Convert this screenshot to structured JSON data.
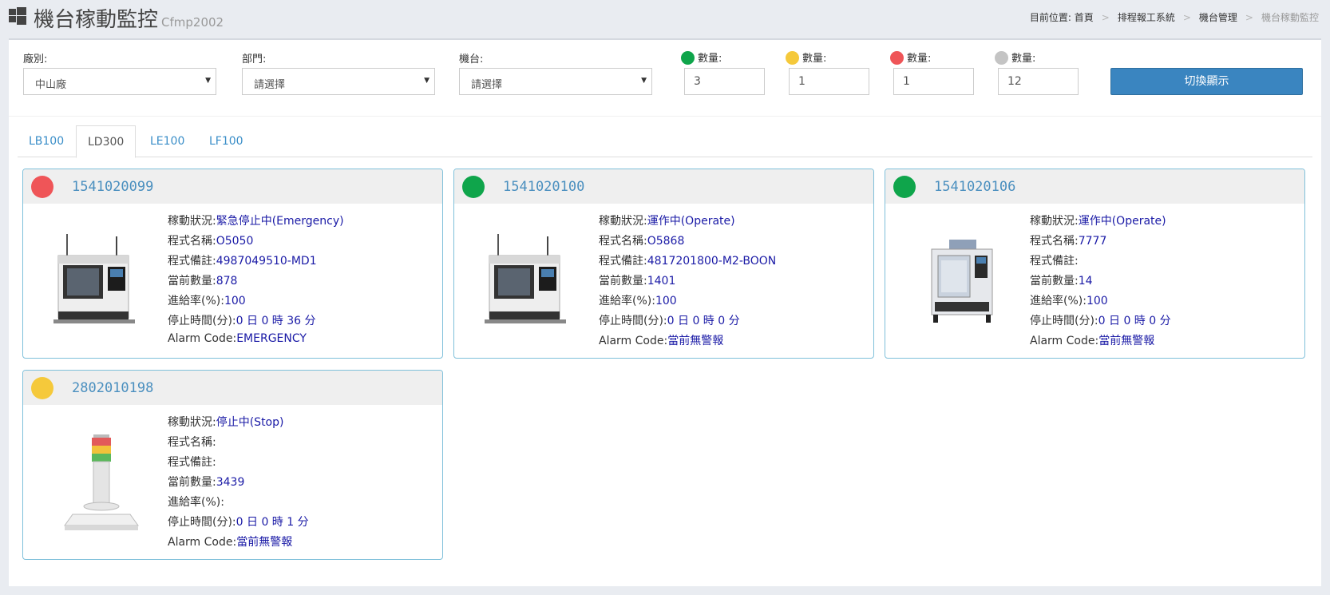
{
  "header": {
    "title": "機台稼動監控",
    "subtitle": "Cfmp2002",
    "breadcrumb": [
      "目前位置: 首頁",
      "排程報工系統",
      "機台管理",
      "機台稼動監控"
    ]
  },
  "filters": {
    "factory_label": "廠別:",
    "factory_value": "中山廠",
    "department_label": "部門:",
    "department_value": "請選擇",
    "machine_label": "機台:",
    "machine_value": "請選擇",
    "counts": [
      {
        "label": "數量:",
        "value": "3",
        "color": "#0fa54b"
      },
      {
        "label": "數量:",
        "value": "1",
        "color": "#f5c93b"
      },
      {
        "label": "數量:",
        "value": "1",
        "color": "#ef5558"
      },
      {
        "label": "數量:",
        "value": "12",
        "color": "#c4c4c4"
      }
    ],
    "toggle_label": "切換顯示"
  },
  "tabs": [
    "LB100",
    "LD300",
    "LE100",
    "LF100"
  ],
  "active_tab": "LD300",
  "labels": {
    "status": "稼動狀況:",
    "program_name": "程式名稱:",
    "program_note": "程式備註:",
    "current_qty": "當前數量:",
    "feed_rate": "進給率(%):",
    "stop_time": "停止時間(分):",
    "alarm_code": "Alarm Code:"
  },
  "machines": [
    {
      "id": "1541020099",
      "status_color": "#ef5558",
      "status": "緊急停止中(Emergency)",
      "program_name": "O5050",
      "program_note": "4987049510-MD1",
      "current_qty": "878",
      "feed_rate": "100",
      "stop_time": "0 日 0 時 36 分",
      "alarm_code": "EMERGENCY",
      "image": "cnc-machine-image"
    },
    {
      "id": "1541020100",
      "status_color": "#0fa54b",
      "status": "運作中(Operate)",
      "program_name": "O5868",
      "program_note": "4817201800-M2-BOON",
      "current_qty": "1401",
      "feed_rate": "100",
      "stop_time": "0 日 0 時 0 分",
      "alarm_code": "當前無警報",
      "image": "cnc-machine-image"
    },
    {
      "id": "1541020106",
      "status_color": "#0fa54b",
      "status": "運作中(Operate)",
      "program_name": "7777",
      "program_note": "",
      "current_qty": "14",
      "feed_rate": "100",
      "stop_time": "0 日 0 時 0 分",
      "alarm_code": "當前無警報",
      "image": "vertical-machining-center-image"
    },
    {
      "id": "2802010198",
      "status_color": "#f5c93b",
      "status": "停止中(Stop)",
      "program_name": "",
      "program_note": "",
      "current_qty": "3439",
      "feed_rate": "",
      "stop_time": "0 日 0 時 1 分",
      "alarm_code": "當前無警報",
      "image": "signal-tower-image"
    }
  ]
}
